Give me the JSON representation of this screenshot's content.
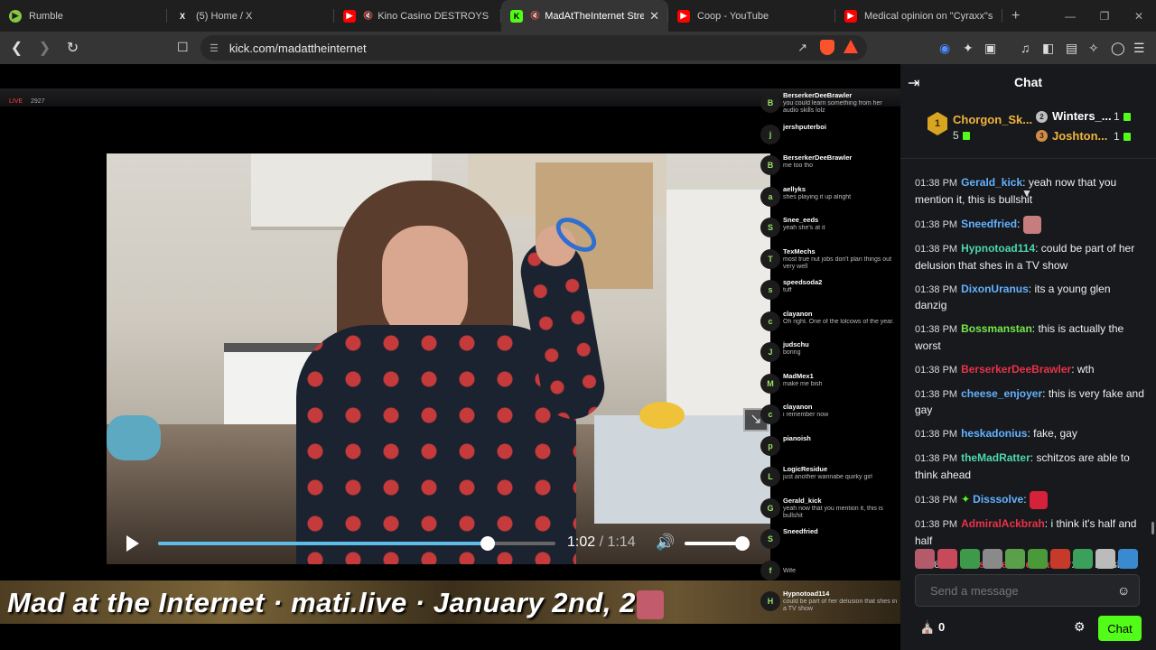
{
  "tabs": [
    {
      "title": "Rumble",
      "icon": "rumble-icon",
      "color": "#85c742"
    },
    {
      "title": "(5) Home / X",
      "icon": "x-icon",
      "color": "#ffffff"
    },
    {
      "title": "Kino Casino DESTROYS DSP",
      "icon": "youtube-icon",
      "color": "#ff0000"
    },
    {
      "title": "MadAtTheInternet Strea",
      "icon": "kick-icon",
      "color": "#53fc18"
    },
    {
      "title": "Coop - YouTube",
      "icon": "youtube-icon",
      "color": "#ff0000"
    },
    {
      "title": "Medical opinion on \"Cyraxx\"s m",
      "icon": "youtube-icon",
      "color": "#ff0000"
    }
  ],
  "url": "kick.com/madattheinternet",
  "stream": {
    "live_label": "LIVE",
    "viewers": "2927",
    "banner": "Mad at the Internet · mati.live · January 2nd, 20",
    "time_current": "1:02",
    "time_total": "/ 1:14",
    "progress": 0.83,
    "volume": 1.0
  },
  "overlay_chat": [
    {
      "name": "BerserkerDeeBrawler",
      "text": "you could learn something from her audio skills lolz",
      "initial": "B"
    },
    {
      "name": "jershputerboi",
      "text": "",
      "initial": "j"
    },
    {
      "name": "BerserkerDeeBrawler",
      "text": "me too tho",
      "initial": "B"
    },
    {
      "name": "aellyks",
      "text": "shes playing it up alright",
      "initial": "a"
    },
    {
      "name": "Snee_eeds",
      "text": "yeah she's at it",
      "initial": "S"
    },
    {
      "name": "TexMechs",
      "text": "most true nut jobs don't plan things out very well",
      "initial": "T"
    },
    {
      "name": "speedsoda2",
      "text": "tuff",
      "initial": "s"
    },
    {
      "name": "clayanon",
      "text": "Oh right. One of the lolcows of the year.",
      "initial": "c"
    },
    {
      "name": "judschu",
      "text": "boring",
      "initial": "J"
    },
    {
      "name": "MadMex1",
      "text": "make me bish",
      "initial": "M"
    },
    {
      "name": "clayanon",
      "text": "i remember now",
      "initial": "c"
    },
    {
      "name": "pianoish",
      "text": "",
      "initial": "p"
    },
    {
      "name": "LogicResidue",
      "text": "just another wannabe quirky girl",
      "initial": "L"
    },
    {
      "name": "Gerald_kick",
      "text": "yeah now that you mention it, this is bullshit",
      "initial": "G"
    },
    {
      "name": "Sneedfried",
      "text": "",
      "initial": "S"
    },
    {
      "name": "",
      "text": "Wife",
      "initial": "f"
    },
    {
      "name": "Hypnotoad114",
      "text": "could be part of her delusion that shes in a TV show",
      "initial": "H"
    }
  ],
  "chat": {
    "title": "Chat",
    "top_gifters": [
      {
        "rank": "1",
        "name": "Chorgon_Sk...",
        "count": "5"
      },
      {
        "rank": "2",
        "name": "Winters_...",
        "count": "1"
      },
      {
        "rank": "3",
        "name": "Joshton...",
        "count": "1"
      }
    ],
    "messages": [
      {
        "time": "01:38 PM",
        "user": "Gerald_kick",
        "color": "#62b2ff",
        "text": "yeah now that you mention it, this is bullshit"
      },
      {
        "time": "01:38 PM",
        "user": "Sneedfried",
        "color": "#62b2ff",
        "text": "",
        "emote": "#c67d7d"
      },
      {
        "time": "01:38 PM",
        "user": "Hypnotoad114",
        "color": "#4cd8a8",
        "text": "could be part of her delusion that shes in a TV show"
      },
      {
        "time": "01:38 PM",
        "user": "DixonUranus",
        "color": "#62b2ff",
        "text": "its a young glen danzig"
      },
      {
        "time": "01:38 PM",
        "user": "Bossmanstan",
        "color": "#76e84a",
        "text": "this is actually the worst"
      },
      {
        "time": "01:38 PM",
        "user": "BerserkerDeeBrawler",
        "color": "#e8324a",
        "text": "wth"
      },
      {
        "time": "01:38 PM",
        "user": "cheese_enjoyer",
        "color": "#62b2ff",
        "text": "this is very fake and gay"
      },
      {
        "time": "01:38 PM",
        "user": "heskadonius",
        "color": "#62b2ff",
        "text": "fake, gay"
      },
      {
        "time": "01:38 PM",
        "user": "theMadRatter",
        "color": "#4cd8a8",
        "text": "schitzos are able to think ahead"
      },
      {
        "time": "01:38 PM",
        "user": "Disssolve",
        "color": "#62b2ff",
        "text": "",
        "emote": "#d5213a",
        "star": true
      },
      {
        "time": "01:38 PM",
        "user": "AdmiralAckbrah",
        "color": "#e8324a",
        "text": "i think it's half and half"
      },
      {
        "time": "01:38 PM",
        "user": "BerserkerDeeBrawler",
        "color": "#e8324a",
        "text": "cut it bish"
      }
    ],
    "emote_strip": [
      "#b45a6a",
      "#c74a5a",
      "#3e9a4a",
      "#8a8a8a",
      "#5aa04a",
      "#4a9a3a",
      "#c63a2a",
      "#3aa05a",
      "#bbbbbb",
      "#3a8acf"
    ],
    "input_placeholder": "Send a message",
    "points": "0",
    "send_label": "Chat"
  },
  "colors": {
    "accent": "#53fc18",
    "panel": "#18191c"
  }
}
